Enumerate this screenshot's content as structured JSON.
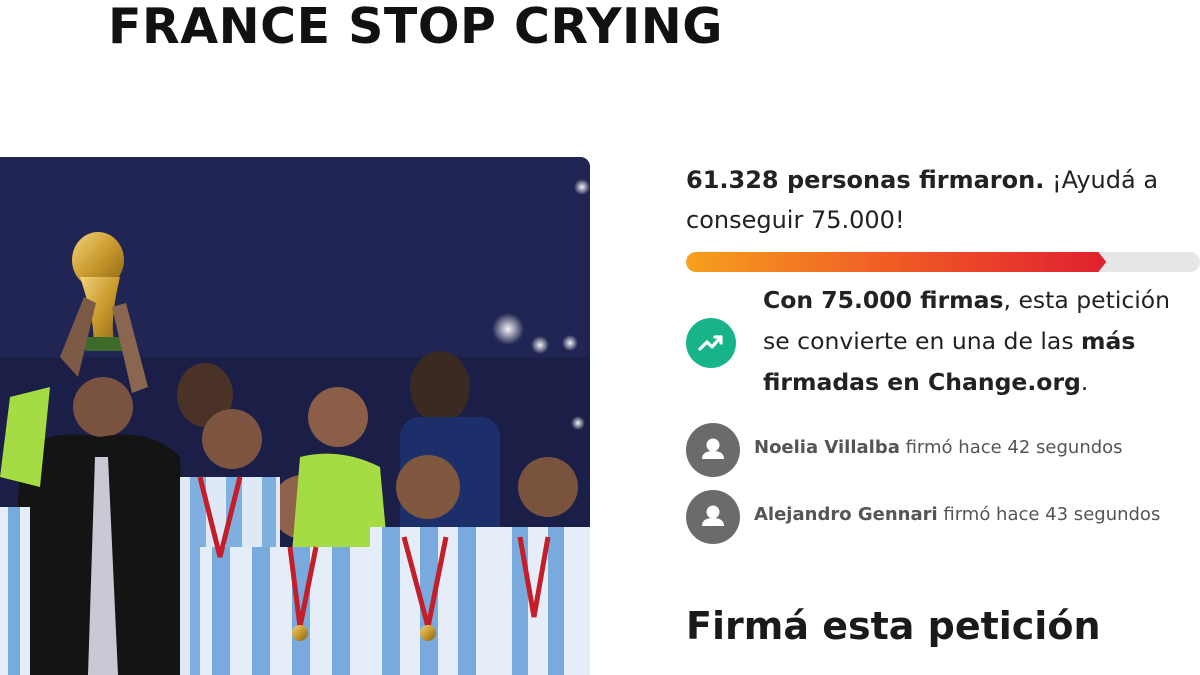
{
  "petition": {
    "title": "FRANCE STOP CRYING",
    "photo_alt": "Argentina players celebrating with the World Cup trophy"
  },
  "progress": {
    "signed_count_text": "61.328 personas firmaron.",
    "goal_text": " ¡Ayudá a conseguir 75.000!",
    "signed_count": 61328,
    "goal": 75000,
    "fraction": 0.8177,
    "colors": {
      "start": "#f7a01c",
      "end": "#e0202f",
      "track": "#e6e6e6"
    }
  },
  "milestone": {
    "icon": "trending-up-icon",
    "icon_color": "#17b489",
    "bold_1": "Con 75.000 firmas",
    "text_1": ", esta petición se convierte en una de las ",
    "bold_2": "más firmadas en Change.org",
    "text_2": "."
  },
  "recent_signers": [
    {
      "name": "Noelia Villalba",
      "action": " firmó hace 42 segundos",
      "icon": "user-avatar-icon"
    },
    {
      "name": "Alejandro Gennari",
      "action": " firmó hace 43 segundos",
      "icon": "user-avatar-icon"
    }
  ],
  "sign_form": {
    "heading": "Firmá esta petición"
  }
}
